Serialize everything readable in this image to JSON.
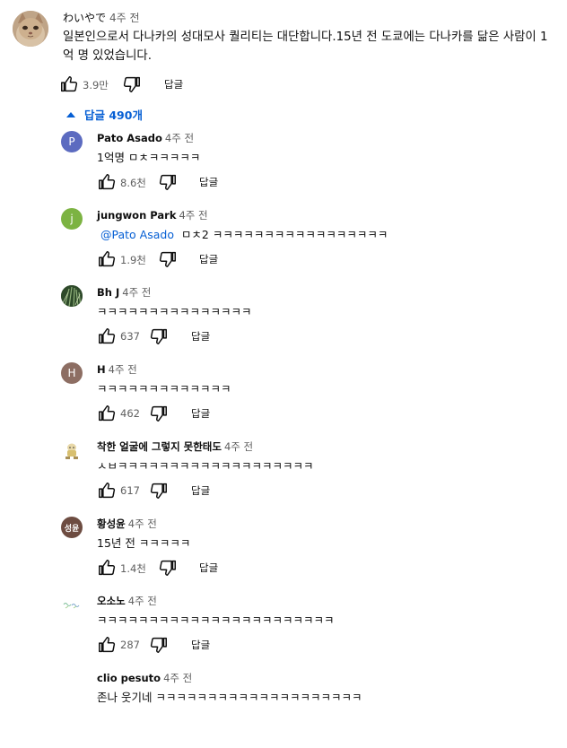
{
  "top_comment": {
    "author": "わいやで",
    "time": "4주 전",
    "text": "일본인으로서  다나카의 성대모사 퀄리티는 대단합니다.15년 전 도쿄에는 다나카를 닮은 사람이 1억 명 있었습니다.",
    "likes": "3.9만",
    "reply_label": "답글"
  },
  "replies_toggle": {
    "label": "답글 490개"
  },
  "colors": {
    "link": "#065fd4",
    "secondary": "#606060"
  },
  "replies": [
    {
      "author": "Pato Asado",
      "time": "4주 전",
      "avatar_letter": "P",
      "avatar_color": "#5c6bc0",
      "text": "1억명 ㅁㅊㅋㅋㅋㅋㅋ",
      "mention": "",
      "likes": "8.6천",
      "reply_label": "답글"
    },
    {
      "author": "jungwon Park",
      "time": "4주 전",
      "avatar_letter": "j",
      "avatar_color": "#7cb342",
      "text": "ㅁㅊ2 ㅋㅋㅋㅋㅋㅋㅋㅋㅋㅋㅋㅋㅋㅋㅋㅋㅋ",
      "mention": "@Pato Asado",
      "likes": "1.9천",
      "reply_label": "답글"
    },
    {
      "author": "Bh J",
      "time": "4주 전",
      "avatar_letter": "",
      "avatar_color": "#3f5a3a",
      "text": "ㅋㅋㅋㅋㅋㅋㅋㅋㅋㅋㅋㅋㅋㅋㅋ",
      "mention": "",
      "likes": "637",
      "reply_label": "답글"
    },
    {
      "author": "H",
      "time": "4주 전",
      "avatar_letter": "H",
      "avatar_color": "#8d6e63",
      "text": "ㅋㅋㅋㅋㅋㅋㅋㅋㅋㅋㅋㅋㅋ",
      "mention": "",
      "likes": "462",
      "reply_label": "답글"
    },
    {
      "author": "착한 얼굴에 그렇지 못한태도",
      "time": "4주 전",
      "avatar_letter": "",
      "avatar_color": "#ffffff",
      "text": "ㅅㅂㅋㅋㅋㅋㅋㅋㅋㅋㅋㅋㅋㅋㅋㅋㅋㅋㅋㅋㅋ",
      "mention": "",
      "likes": "617",
      "reply_label": "답글"
    },
    {
      "author": "황성윤",
      "time": "4주 전",
      "avatar_letter": "성윤",
      "avatar_color": "#6d4c41",
      "text": "15년 전 ㅋㅋㅋㅋㅋ",
      "mention": "",
      "likes": "1.4천",
      "reply_label": "답글"
    },
    {
      "author": "오소노",
      "time": "4주 전",
      "avatar_letter": "",
      "avatar_color": "#ffffff",
      "text": "ㅋㅋㅋㅋㅋㅋㅋㅋㅋㅋㅋㅋㅋㅋㅋㅋㅋㅋㅋㅋㅋㅋㅋ",
      "mention": "",
      "likes": "287",
      "reply_label": "답글"
    },
    {
      "author": "clio pesuto",
      "time": "4주 전",
      "avatar_letter": "",
      "avatar_color": "#ffffff",
      "text": "존나 웃기네 ㅋㅋㅋㅋㅋㅋㅋㅋㅋㅋㅋㅋㅋㅋㅋㅋㅋㅋㅋㅋ",
      "mention": "",
      "likes": "",
      "reply_label": ""
    }
  ]
}
